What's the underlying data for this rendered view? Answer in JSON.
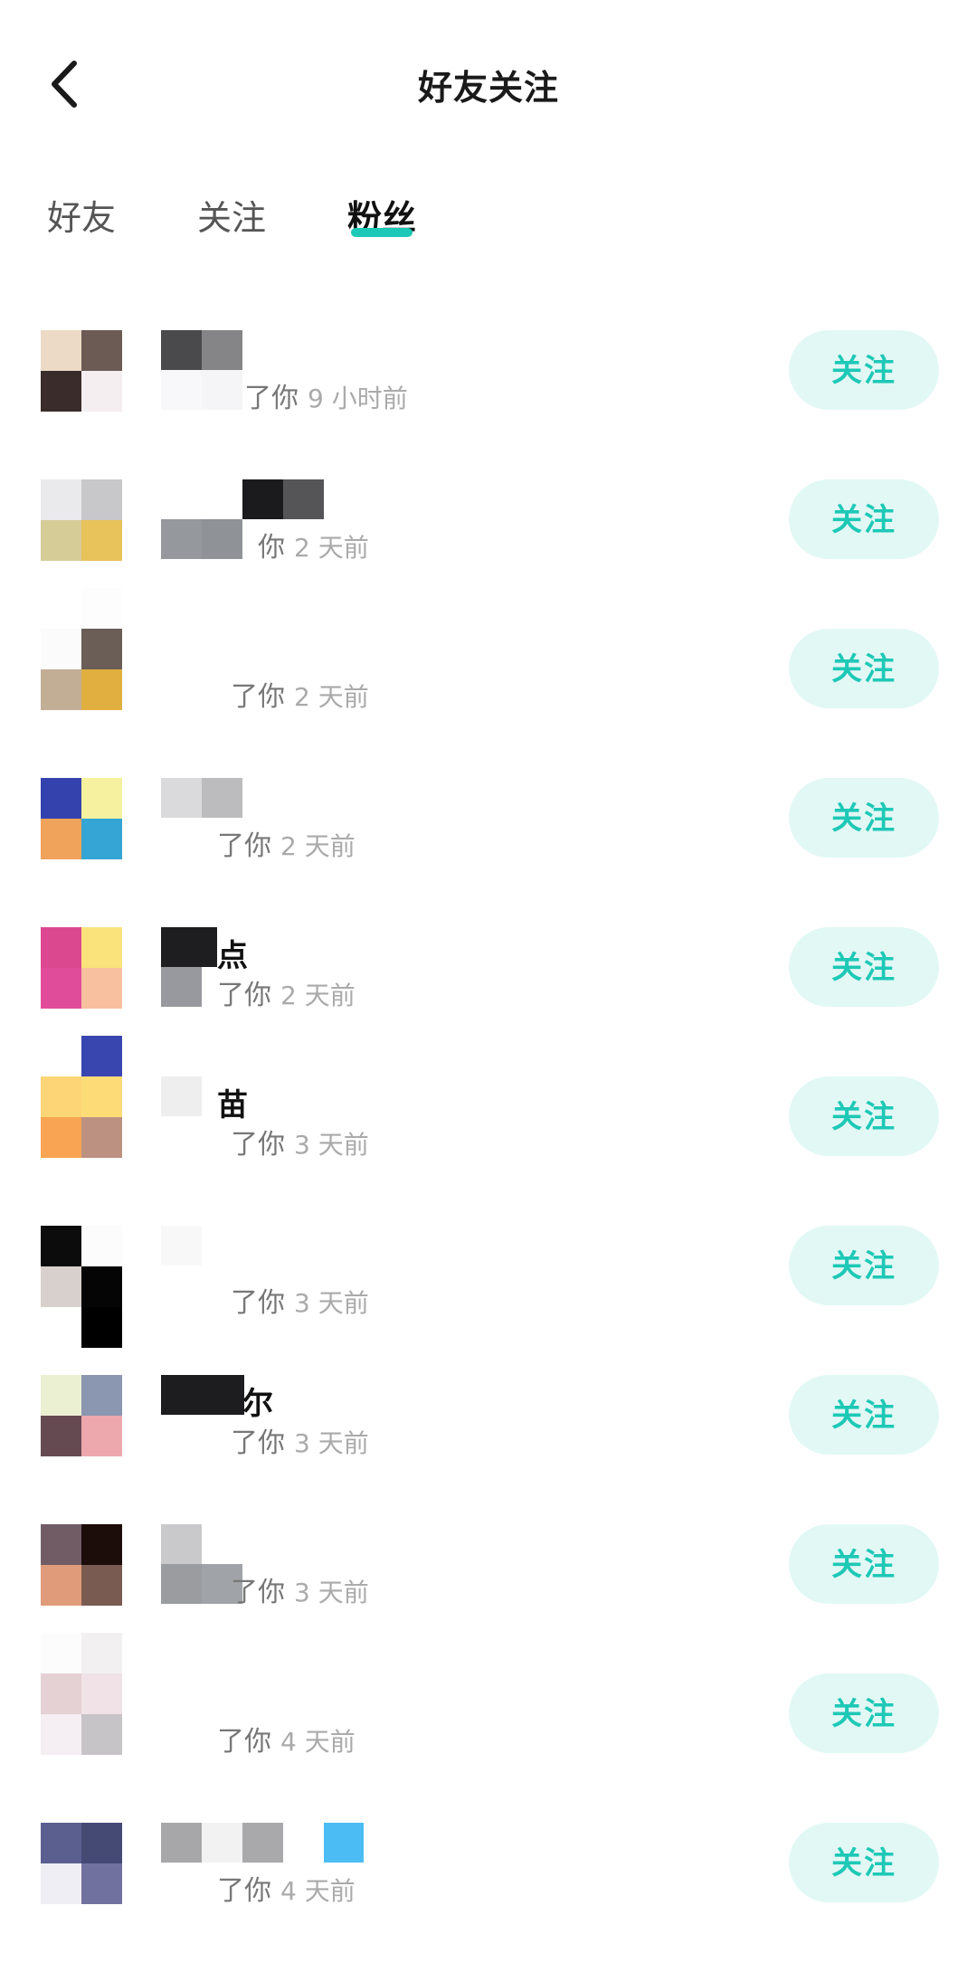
{
  "header": {
    "title": "好友关注",
    "back_icon": "chevron-left-icon"
  },
  "tabs": [
    {
      "label": "好友",
      "active": false
    },
    {
      "label": "关注",
      "active": false
    },
    {
      "label": "粉丝",
      "active": true
    }
  ],
  "colors": {
    "accent": "#1ec8b6",
    "button_bg": "#e2f8f5"
  },
  "followers": [
    {
      "name_visible": "",
      "action_visible": "了你",
      "time": "9 小时前",
      "button": "关注"
    },
    {
      "name_visible": "",
      "action_visible": "你",
      "time": "2 天前",
      "button": "关注"
    },
    {
      "name_visible": "",
      "action_visible": "了你",
      "time": "2 天前",
      "button": "关注"
    },
    {
      "name_visible": "",
      "action_visible": "了你",
      "time": "2 天前",
      "button": "关注"
    },
    {
      "name_visible": "点",
      "action_visible": "了你",
      "time": "2 天前",
      "button": "关注"
    },
    {
      "name_visible": "苗",
      "action_visible": "了你",
      "time": "3 天前",
      "button": "关注"
    },
    {
      "name_visible": "",
      "action_visible": "了你",
      "time": "3 天前",
      "button": "关注"
    },
    {
      "name_visible": "尔",
      "action_visible": "了你",
      "time": "3 天前",
      "button": "关注"
    },
    {
      "name_visible": "",
      "action_visible": "了你",
      "time": "3 天前",
      "button": "关注"
    },
    {
      "name_visible": "",
      "action_visible": "了你",
      "time": "4 天前",
      "button": "关注"
    },
    {
      "name_visible": "",
      "action_visible": "了你",
      "time": "4 天前",
      "button": "关注"
    }
  ]
}
